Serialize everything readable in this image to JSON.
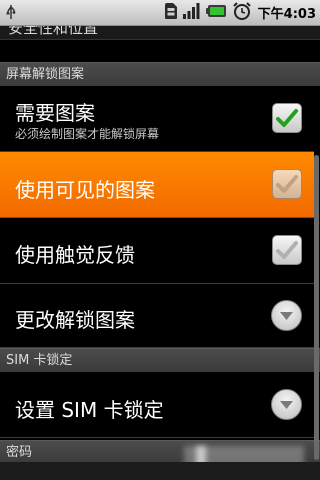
{
  "status_bar": {
    "time": "下午4:03",
    "icons": [
      "usb-icon",
      "sim-icon",
      "signal-icon",
      "battery-icon",
      "alarm-icon"
    ]
  },
  "screen": {
    "title_peek": "安全性和位置"
  },
  "sections": {
    "screen_unlock": {
      "header": "屏幕解锁图案",
      "require_pattern": {
        "title": "需要图案",
        "summary": "必须绘制图案才能解锁屏幕",
        "checked": true
      },
      "use_visible_pattern": {
        "title": "使用可见的图案",
        "checked": true
      },
      "use_tactile_feedback": {
        "title": "使用触觉反馈",
        "checked": true
      },
      "change_unlock_pattern": {
        "title": "更改解锁图案"
      }
    },
    "sim_lock": {
      "header": "SIM 卡锁定",
      "set_sim_lock": {
        "title": "设置 SIM 卡锁定"
      }
    },
    "passwords": {
      "header": "密码"
    }
  },
  "colors": {
    "highlight": "#ff7f00",
    "check_green": "#1fa31f",
    "check_disabled": "#b0b0b0"
  }
}
